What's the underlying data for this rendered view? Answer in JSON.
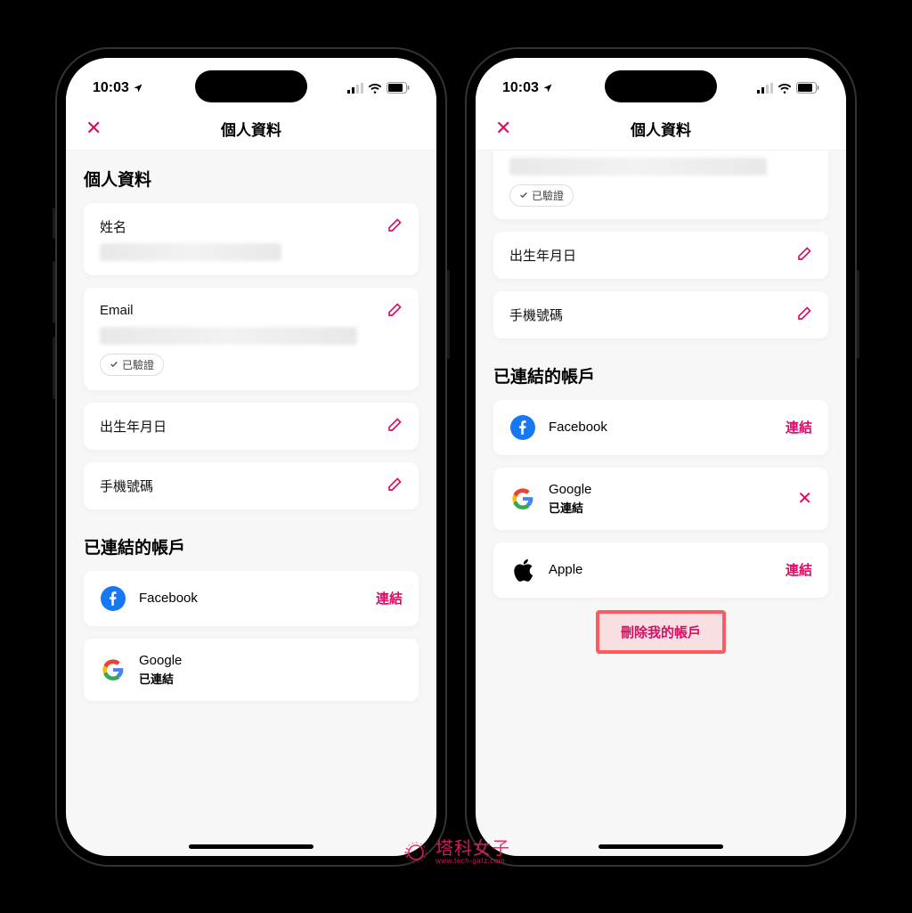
{
  "status": {
    "time": "10:03"
  },
  "nav": {
    "title": "個人資料"
  },
  "section": {
    "personal_title": "個人資料",
    "linked_title": "已連結的帳戶"
  },
  "fields": {
    "name_label": "姓名",
    "email_label": "Email",
    "dob_label": "出生年月日",
    "phone_label": "手機號碼"
  },
  "badge": {
    "verified": "已驗證"
  },
  "accounts": {
    "facebook": "Facebook",
    "google": "Google",
    "apple": "Apple",
    "link_action": "連結",
    "linked_status": "已連結"
  },
  "delete": {
    "label": "刪除我的帳戶"
  },
  "watermark": {
    "main": "塔科女子",
    "sub": "www.tech-girlz.com"
  }
}
